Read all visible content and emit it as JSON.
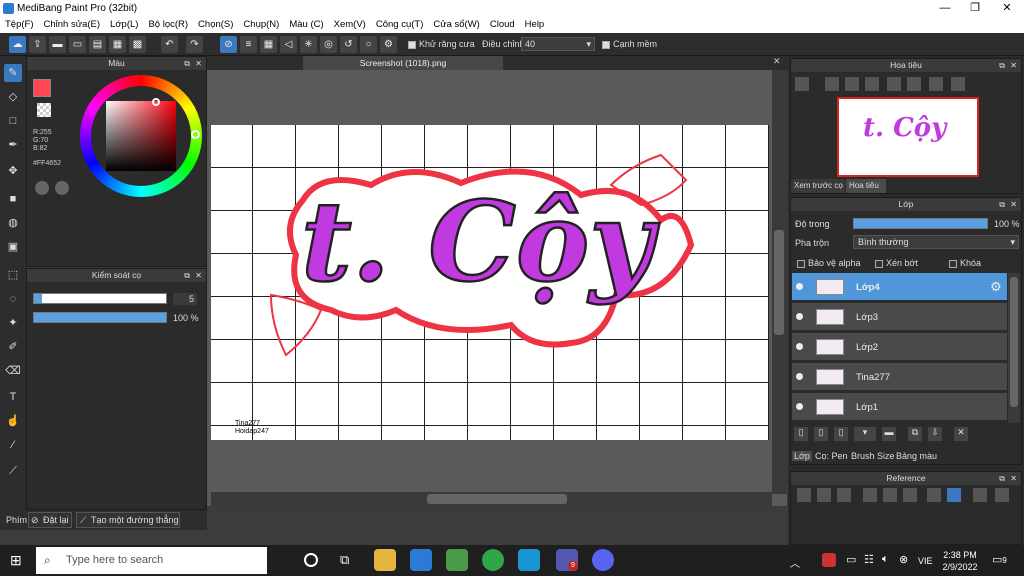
{
  "window": {
    "title": "MediBang Paint Pro (32bit)",
    "min": "—",
    "max": "❐",
    "close": "✕"
  },
  "menu": [
    "Tệp(F)",
    "Chỉnh sửa(E)",
    "Lớp(L)",
    "Bộ lọc(R)",
    "Chọn(S)",
    "Chụp(N)",
    "Màu (C)",
    "Xem(V)",
    "Công cụ(T)",
    "Cửa sổ(W)",
    "Cloud",
    "Help"
  ],
  "toolbar": {
    "antialias_label": "Khử răng cưa",
    "adjust_label": "Điều chỉnh",
    "adjust_value": "40",
    "edge_label": "Cạnh mềm"
  },
  "color_panel": {
    "title": "Màu",
    "r": "R:255",
    "g": "G:70",
    "b": "B:82",
    "hex": "#FF4652",
    "primary_color": "#ff4652"
  },
  "brush_panel": {
    "title": "Kiểm soát cọ",
    "size": "5",
    "opacity": "100 %",
    "size_fill": 0.06,
    "opacity_fill": 1.0
  },
  "document": {
    "tab": "Screenshot (1018).png",
    "watermark1": "Tina277",
    "watermark2": "Hoidap247",
    "art_text": "t. Cộy"
  },
  "navigator": {
    "title": "Hoa tiêu",
    "tab1": "Xem trước cọ",
    "tab2": "Hoa tiêu"
  },
  "layers": {
    "title": "Lớp",
    "opacity_label": "Độ trong",
    "opacity_value": "100 %",
    "blend_label": "Pha trộn",
    "blend_value": "Bình thường",
    "protect_alpha": "Bảo vệ alpha",
    "clipping": "Xén bớt",
    "lock": "Khóa",
    "items": [
      {
        "name": "Lớp4"
      },
      {
        "name": "Lớp3"
      },
      {
        "name": "Lớp2"
      },
      {
        "name": "Tina277"
      },
      {
        "name": "Lớp1"
      }
    ],
    "tabs": [
      "Lớp",
      "Cọ: Pen",
      "Brush Size",
      "Bảng màu"
    ]
  },
  "reference": {
    "title": "Reference"
  },
  "statusbar": {
    "label": "Phím",
    "reset": "Đặt lại",
    "line": "Tạo một đường thẳng"
  },
  "taskbar": {
    "search_placeholder": "Type here to search",
    "lang": "VIE",
    "time": "2:38 PM",
    "date": "2/9/2022",
    "notif": "9",
    "teams_badge": "9"
  }
}
